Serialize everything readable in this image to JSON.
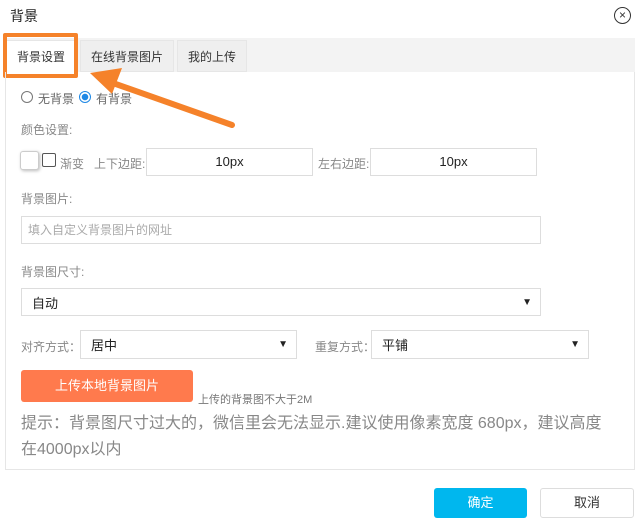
{
  "dialog": {
    "title": "背景",
    "close_icon": "close-circle-icon"
  },
  "tabs": [
    {
      "label": "背景设置",
      "active": true
    },
    {
      "label": "在线背景图片"
    },
    {
      "label": "我的上传"
    }
  ],
  "radios": {
    "none": "无背景",
    "has": "有背景",
    "selected": "has"
  },
  "color": {
    "label": "颜色设置:",
    "gradient": "渐变",
    "tb_label": "上下边距:",
    "tb_value": "10px",
    "lr_label": "左右边距:",
    "lr_value": "10px"
  },
  "image": {
    "label": "背景图片:",
    "placeholder": "填入自定义背景图片的网址"
  },
  "size": {
    "label": "背景图尺寸:",
    "value": "自动"
  },
  "align": {
    "label": "对齐方式：",
    "value": "居中"
  },
  "repeat": {
    "label": "重复方式：",
    "value": "平铺"
  },
  "upload": {
    "button": "上传本地背景图片",
    "note": "上传的背景图不大于2M"
  },
  "hint": "提示：背景图尺寸过大的，微信里会无法显示.建议使用像素宽度 680px，建议高度在4000px以内",
  "footer": {
    "ok": "确定",
    "cancel": "取消"
  },
  "colors": {
    "accent": "#ff7a4d",
    "primary": "#00b7ee",
    "highlight": "#f5822a"
  }
}
